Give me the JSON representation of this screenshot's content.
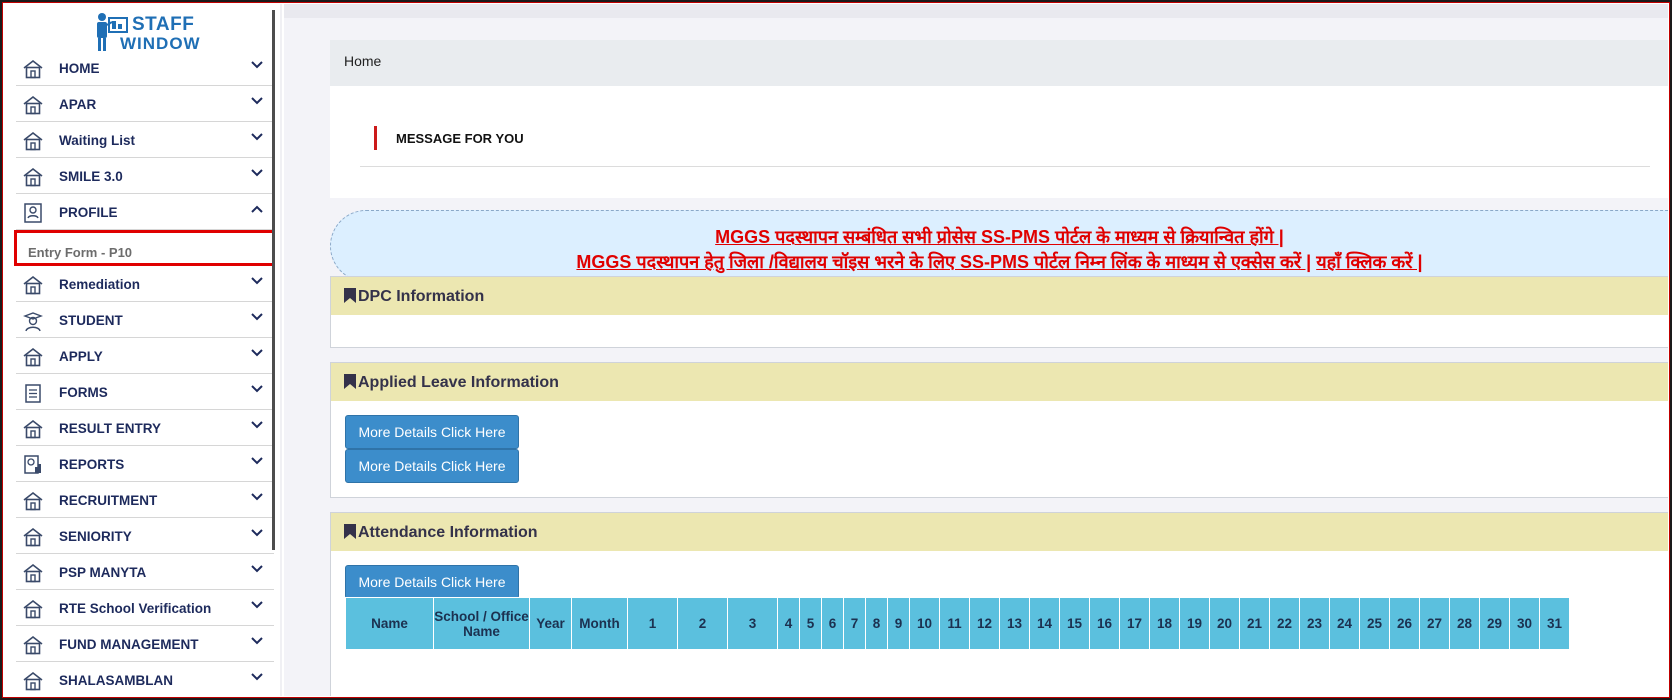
{
  "logo": {
    "line1": "STAFF",
    "line2": "WINDOW"
  },
  "sidebar": {
    "items": [
      {
        "label": "HOME",
        "icon": "house-icon",
        "state": "collapsed"
      },
      {
        "label": "APAR",
        "icon": "house-icon",
        "state": "collapsed"
      },
      {
        "label": "Waiting List",
        "icon": "house-icon",
        "state": "collapsed"
      },
      {
        "label": "SMILE 3.0",
        "icon": "house-icon",
        "state": "collapsed"
      },
      {
        "label": "PROFILE",
        "icon": "profile-card-icon",
        "state": "expanded"
      },
      {
        "label": "Remediation",
        "icon": "house-icon",
        "state": "collapsed"
      },
      {
        "label": "STUDENT",
        "icon": "student-icon",
        "state": "collapsed"
      },
      {
        "label": "APPLY",
        "icon": "house-icon",
        "state": "collapsed"
      },
      {
        "label": "FORMS",
        "icon": "clipboard-icon",
        "state": "collapsed"
      },
      {
        "label": "RESULT ENTRY",
        "icon": "house-icon",
        "state": "collapsed"
      },
      {
        "label": "REPORTS",
        "icon": "report-icon",
        "state": "collapsed"
      },
      {
        "label": "RECRUITMENT",
        "icon": "house-icon",
        "state": "collapsed"
      },
      {
        "label": "SENIORITY",
        "icon": "house-icon",
        "state": "collapsed"
      },
      {
        "label": "PSP MANYTA",
        "icon": "house-icon",
        "state": "collapsed"
      },
      {
        "label": "RTE School Verification",
        "icon": "house-icon",
        "state": "collapsed"
      },
      {
        "label": "FUND MANAGEMENT",
        "icon": "house-icon",
        "state": "collapsed"
      },
      {
        "label": "SHALASAMBLAN",
        "icon": "house-icon",
        "state": "collapsed"
      }
    ],
    "profile_submenu": {
      "label": "Entry Form - P10",
      "highlight_color": "#e00000"
    }
  },
  "breadcrumb": {
    "label": "Home"
  },
  "message": {
    "title": "MESSAGE FOR YOU"
  },
  "notice": {
    "line1": "MGGS पदस्थापन सम्बंधित सभी प्रोसेस SS-PMS पोर्टल के माध्यम से क्रियान्वित होंगे |",
    "line2_part1": "MGGS पदस्थापन हेतु जिला /विद्यालय चॉइस भरने के लिए SS-PMS पोर्टल निम्न लिंक के माध्यम से एक्सेस करें |",
    "line2_link": "यहाँ क्लिक करें |",
    "color": "#e00000"
  },
  "panels": {
    "dpc": {
      "title": "DPC Information"
    },
    "leave": {
      "title": "Applied Leave Information",
      "button1": "More Details Click Here",
      "button2": "More Details Click Here"
    },
    "attendance": {
      "title": "Attendance Information",
      "button": "More Details Click Here",
      "columns": [
        "Name",
        "School / Office Name",
        "Year",
        "Month",
        "1",
        "2",
        "3",
        "4",
        "5",
        "6",
        "7",
        "8",
        "9",
        "10",
        "11",
        "12",
        "13",
        "14",
        "15",
        "16",
        "17",
        "18",
        "19",
        "20",
        "21",
        "22",
        "23",
        "24",
        "25",
        "26",
        "27",
        "28",
        "29",
        "30",
        "31"
      ]
    }
  },
  "colors": {
    "header_band": "#ece7b1",
    "button": "#3c8dcb",
    "table_header": "#5bc0de",
    "menu_text": "#1d2a5c"
  }
}
